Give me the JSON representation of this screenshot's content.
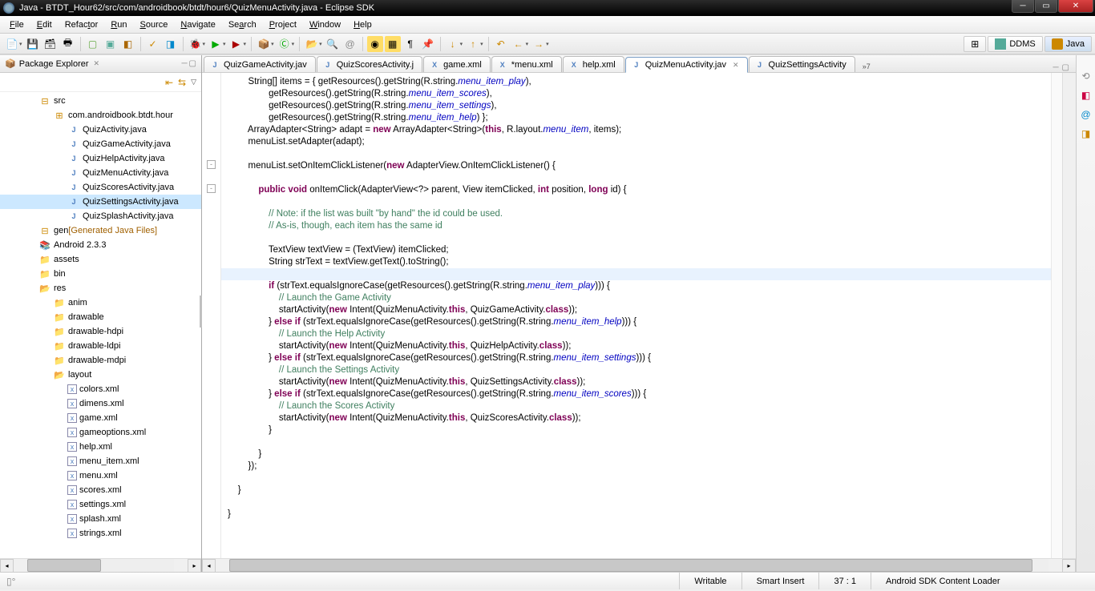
{
  "titlebar": {
    "text": "Java - BTDT_Hour62/src/com/androidbook/btdt/hour6/QuizMenuActivity.java - Eclipse SDK"
  },
  "menubar": {
    "items": [
      "File",
      "Edit",
      "Refactor",
      "Run",
      "Source",
      "Navigate",
      "Search",
      "Project",
      "Window",
      "Help"
    ]
  },
  "perspectives": {
    "ddms": "DDMS",
    "java": "Java"
  },
  "package_explorer": {
    "title": "Package Explorer",
    "tree": {
      "src": "src",
      "pkg": "com.androidbook.btdt.hour",
      "files": [
        "QuizActivity.java",
        "QuizGameActivity.java",
        "QuizHelpActivity.java",
        "QuizMenuActivity.java",
        "QuizScoresActivity.java",
        "QuizSettingsActivity.java",
        "QuizSplashActivity.java"
      ],
      "gen": "gen",
      "gen_label": "[Generated Java Files]",
      "android": "Android 2.3.3",
      "assets": "assets",
      "bin": "bin",
      "res": "res",
      "res_folders": [
        "anim",
        "drawable",
        "drawable-hdpi",
        "drawable-ldpi",
        "drawable-mdpi",
        "layout"
      ],
      "layout_files": [
        "colors.xml",
        "dimens.xml",
        "game.xml",
        "gameoptions.xml",
        "help.xml",
        "menu_item.xml",
        "menu.xml",
        "scores.xml",
        "settings.xml",
        "splash.xml",
        "strings.xml"
      ]
    }
  },
  "editor_tabs": {
    "tabs": [
      {
        "label": "QuizGameActivity.jav",
        "icon": "J"
      },
      {
        "label": "QuizScoresActivity.j",
        "icon": "J"
      },
      {
        "label": "game.xml",
        "icon": "X"
      },
      {
        "label": "*menu.xml",
        "icon": "X"
      },
      {
        "label": "help.xml",
        "icon": "X"
      },
      {
        "label": "QuizMenuActivity.jav",
        "icon": "J",
        "active": true
      },
      {
        "label": "QuizSettingsActivity",
        "icon": "J"
      }
    ],
    "overflow": "»7"
  },
  "code": {
    "lines": [
      {
        "t": "        String[] items = { getResources().getString(R.string.<f>menu_item_play</f>),"
      },
      {
        "t": "                getResources().getString(R.string.<f>menu_item_scores</f>),"
      },
      {
        "t": "                getResources().getString(R.string.<f>menu_item_settings</f>),"
      },
      {
        "t": "                getResources().getString(R.string.<f>menu_item_help</f>) };"
      },
      {
        "t": "        ArrayAdapter<String> adapt = <k>new</k> ArrayAdapter<String>(<k>this</k>, R.layout.<f>menu_item</f>, items);"
      },
      {
        "t": "        menuList.setAdapter(adapt);"
      },
      {
        "t": ""
      },
      {
        "t": "        menuList.setOnItemClickListener(<k>new</k> AdapterView.OnItemClickListener() {"
      },
      {
        "t": ""
      },
      {
        "t": "            <k>public</k> <k>void</k> onItemClick(AdapterView<?> parent, View itemClicked, <k>int</k> position, <k>long</k> id) {"
      },
      {
        "t": ""
      },
      {
        "t": "                <c>// Note: if the list was built \"by hand\" the id could be used.</c>"
      },
      {
        "t": "                <c>// As-is, though, each item has the same id</c>"
      },
      {
        "t": ""
      },
      {
        "t": "                TextView textView = (TextView) itemClicked;"
      },
      {
        "t": "                String strText = textView.getText().toString();"
      },
      {
        "t": "",
        "hl": true
      },
      {
        "t": "                <k>if</k> (strText.equalsIgnoreCase(getResources().getString(R.string.<f>menu_item_play</f>))) {"
      },
      {
        "t": "                    <c>// Launch the Game Activity</c>"
      },
      {
        "t": "                    startActivity(<k>new</k> Intent(QuizMenuActivity.<k>this</k>, QuizGameActivity.<k>class</k>));"
      },
      {
        "t": "                } <k>else</k> <k>if</k> (strText.equalsIgnoreCase(getResources().getString(R.string.<f>menu_item_help</f>))) {"
      },
      {
        "t": "                    <c>// Launch the Help Activity</c>"
      },
      {
        "t": "                    startActivity(<k>new</k> Intent(QuizMenuActivity.<k>this</k>, QuizHelpActivity.<k>class</k>));"
      },
      {
        "t": "                } <k>else</k> <k>if</k> (strText.equalsIgnoreCase(getResources().getString(R.string.<f>menu_item_settings</f>))) {"
      },
      {
        "t": "                    <c>// Launch the Settings Activity</c>"
      },
      {
        "t": "                    startActivity(<k>new</k> Intent(QuizMenuActivity.<k>this</k>, QuizSettingsActivity.<k>class</k>));"
      },
      {
        "t": "                } <k>else</k> <k>if</k> (strText.equalsIgnoreCase(getResources().getString(R.string.<f>menu_item_scores</f>))) {"
      },
      {
        "t": "                    <c>// Launch the Scores Activity</c>"
      },
      {
        "t": "                    startActivity(<k>new</k> Intent(QuizMenuActivity.<k>this</k>, QuizScoresActivity.<k>class</k>));"
      },
      {
        "t": "                }"
      },
      {
        "t": ""
      },
      {
        "t": "            }"
      },
      {
        "t": "        });"
      },
      {
        "t": ""
      },
      {
        "t": "    }"
      },
      {
        "t": ""
      },
      {
        "t": "}"
      }
    ]
  },
  "statusbar": {
    "writable": "Writable",
    "insert": "Smart Insert",
    "position": "37 : 1",
    "loader": "Android SDK Content Loader"
  }
}
